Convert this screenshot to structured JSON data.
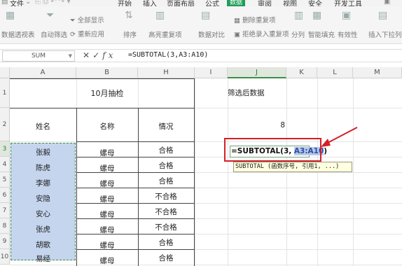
{
  "menu": {
    "file": "文件",
    "tabs": [
      "开始",
      "插入",
      "页面布局",
      "公式",
      "数据",
      "审阅",
      "视图",
      "安全",
      "开发工具"
    ],
    "active_tab": "数据"
  },
  "ribbon": {
    "pivot_table": "数据透视表",
    "auto_filter": "自动筛选",
    "show_all": "全部显示",
    "reapply": "重新应用",
    "sort": "排序",
    "highlight_dup": "高亮重复项",
    "data_compare": "数据对比",
    "delete_dup": "删除重复项",
    "reject_dup": "拒绝录入重复项",
    "split": "分列",
    "smart_fill": "智能填充",
    "validation": "有效性",
    "insert_dropdown": "插入下拉列表"
  },
  "formula_bar": {
    "name_box": "SUM",
    "cancel_icon": "✕",
    "confirm_icon": "✓",
    "fx_label": "fx",
    "formula": "=SUBTOTAL(3,A3:A10)"
  },
  "columns": [
    "A",
    "B",
    "H",
    "I",
    "J",
    "K",
    "L",
    "M"
  ],
  "rows": [
    "1",
    "2",
    "3",
    "4",
    "5",
    "6",
    "7",
    "8",
    "9",
    "10"
  ],
  "table": {
    "title": "10月抽检",
    "headers": [
      "姓名",
      "名称",
      "情况"
    ],
    "records": [
      {
        "name": "张毅",
        "item": "螺母",
        "status": "合格"
      },
      {
        "name": "陈虎",
        "item": "螺母",
        "status": "合格"
      },
      {
        "name": "李娜",
        "item": "螺母",
        "status": "合格"
      },
      {
        "name": "安隐",
        "item": "螺母",
        "status": "不合格"
      },
      {
        "name": "安心",
        "item": "螺母",
        "status": "不合格"
      },
      {
        "name": "张虎",
        "item": "螺母",
        "status": "不合格"
      },
      {
        "name": "胡歌",
        "item": "螺母",
        "status": "合格"
      },
      {
        "name": "易经",
        "item": "螺母",
        "status": "合格"
      }
    ]
  },
  "side": {
    "label": "筛选后数据",
    "value": "8",
    "edit_prefix": "=SUBTOTAL(3, ",
    "edit_range": "A3:A10",
    "edit_suffix": ")",
    "tooltip": "SUBTOTAL (函数序号, 引用1, ...)"
  },
  "colors": {
    "accent": "#1e9e57",
    "annotation": "#d32027",
    "selection_fill": "#c5d5ee"
  }
}
